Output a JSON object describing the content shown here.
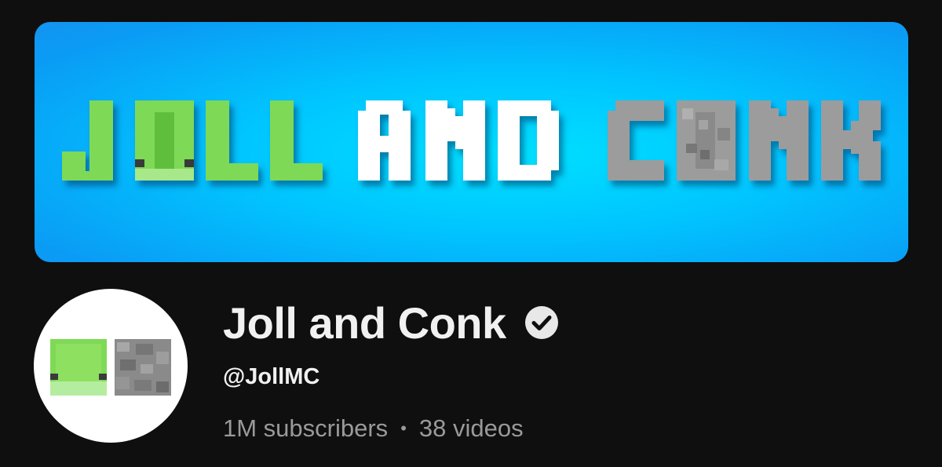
{
  "banner": {
    "title_words": [
      "JOLL",
      "AND",
      "CONK"
    ],
    "colors": {
      "joll": "#7ed957",
      "and": "#ffffff",
      "conk": "#9c9c9c",
      "background": "#00c6ff"
    }
  },
  "avatar": {
    "icons": [
      "green-block-face-icon",
      "stone-block-icon"
    ]
  },
  "channel": {
    "name": "Joll and Conk",
    "verified_icon": "verified-check-icon",
    "handle": "@JollMC",
    "subscribers": "1M subscribers",
    "separator": "•",
    "videos": "38 videos"
  }
}
